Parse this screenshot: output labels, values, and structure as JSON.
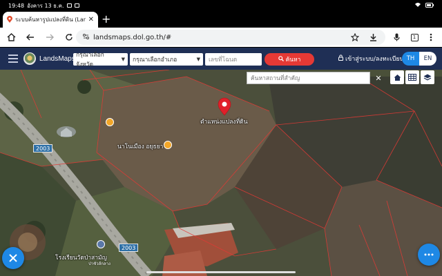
{
  "status_bar": {
    "time": "19:48",
    "date": "อังคาร 13 ธ.ค."
  },
  "browser": {
    "tab_title": "ระบบค้นหารูปแปลงที่ดิน (Lan",
    "new_tab": "+",
    "url": "landsmaps.dol.go.th/#",
    "tab_count": "1"
  },
  "site": {
    "brand": "LandsMaps",
    "province_select": "กรุณาเลือกจังหวัด",
    "district_select": "กรุณาเลือกอำเภอ",
    "deed_placeholder": "เลขที่โฉนด",
    "search_label": "ค้นหา",
    "login_label": "เข้าสู่ระบบ/ลงทะเบียน",
    "lang_th": "TH",
    "lang_en": "EN"
  },
  "map": {
    "place_search_placeholder": "ค้นหาสถานที่สำคัญ",
    "clear_symbol": "✕",
    "pin_label": "ตำแหน่งแปลงที่ดิน",
    "poi_label": "นาโนเมือง อยุธยา",
    "school_label": "โรงเรียนวัดป่าสามัญ",
    "school_sublabel": "ป่าชัวส์กลาง",
    "road_numbers": [
      "2003",
      "2003"
    ]
  },
  "colors": {
    "header_bg": "#1f2f55",
    "search_button": "#e53935",
    "accent_blue": "#1e88e5",
    "parcel_line": "#e53935",
    "pin": "#e0202a"
  }
}
